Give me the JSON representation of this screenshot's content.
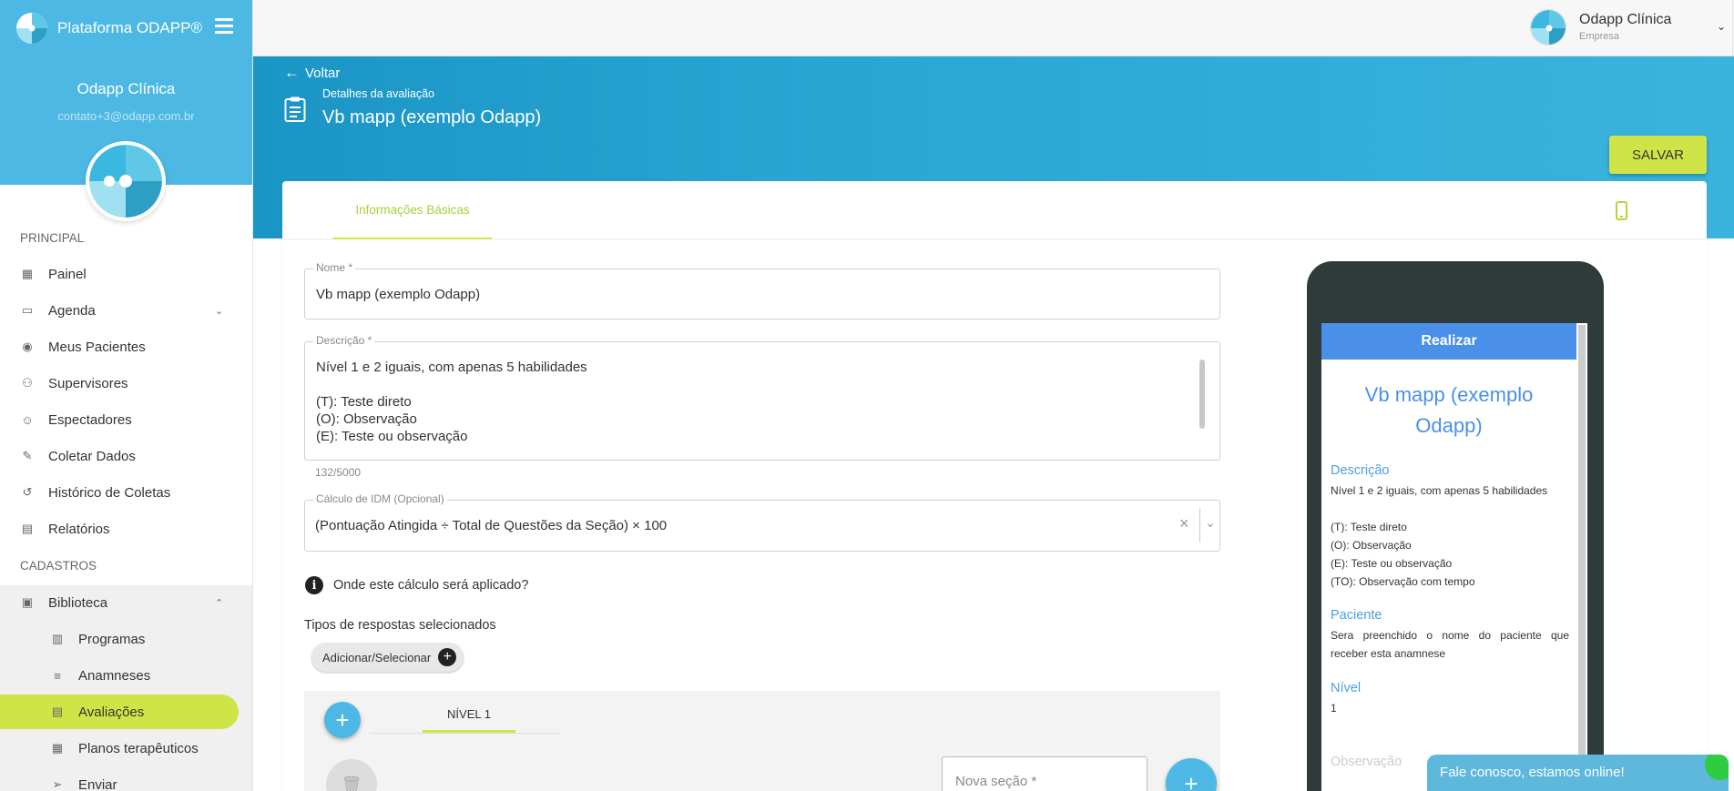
{
  "app": {
    "brand_name": "Plataforma ODAPP®",
    "user_name": "Odapp Clínica",
    "user_email": "contato+3@odapp.com.br"
  },
  "sidebar": {
    "section_principal": "PRINCIPAL",
    "section_cadastros": "CADASTROS",
    "items": [
      {
        "label": "Painel",
        "icon": "dashboard-icon"
      },
      {
        "label": "Agenda",
        "icon": "calendar-icon"
      },
      {
        "label": "Meus Pacientes",
        "icon": "eye-icon"
      },
      {
        "label": "Supervisores",
        "icon": "users-icon"
      },
      {
        "label": "Espectadores",
        "icon": "smile-icon"
      },
      {
        "label": "Coletar Dados",
        "icon": "pencil-icon"
      },
      {
        "label": "Histórico de Coletas",
        "icon": "history-icon"
      },
      {
        "label": "Relatórios",
        "icon": "report-icon"
      },
      {
        "label": "Biblioteca",
        "icon": "library-icon"
      },
      {
        "label": "Programas",
        "icon": "document-icon"
      },
      {
        "label": "Anamneses",
        "icon": "list-icon"
      },
      {
        "label": "Avaliações",
        "icon": "clipboard-icon"
      },
      {
        "label": "Planos terapêuticos",
        "icon": "plan-icon"
      },
      {
        "label": "Enviar",
        "icon": "send-icon"
      }
    ],
    "active_color": "#cfe547"
  },
  "topbar": {
    "company_name": "Odapp Clínica",
    "company_role": "Empresa"
  },
  "header": {
    "back_label": "Voltar",
    "subtitle": "Detalhes da avaliação",
    "title": "Vb mapp (exemplo Odapp)",
    "save_label": "SALVAR"
  },
  "tabs": {
    "basic_info": "Informações Básicas"
  },
  "form": {
    "name_label": "Nome *",
    "name_value": "Vb mapp (exemplo Odapp)",
    "desc_label": "Descrição *",
    "desc_lines": [
      "Nível 1 e 2 iguais, com apenas 5 habilidades",
      "",
      "(T): Teste direto",
      "(O): Observação",
      "(E): Teste ou observação"
    ],
    "desc_counter": "132/5000",
    "idm_label": "Cálculo de IDM (Opcional)",
    "idm_value": "(Pontuação Atingida ÷ Total de Questões da Seção) × 100",
    "idm_help": "Onde este cálculo será aplicado?",
    "response_types_label": "Tipos de respostas selecionados",
    "add_select_label": "Adicionar/Selecionar",
    "level_tab": "NÍVEL 1",
    "new_section_placeholder": "Nova seção *"
  },
  "preview": {
    "header": "Realizar",
    "title": "Vb mapp (exemplo Odapp)",
    "desc_heading": "Descrição",
    "desc_lines": [
      "Nível 1 e 2 iguais, com apenas 5 habilidades",
      "",
      "(T): Teste direto",
      "(O): Observação",
      "(E): Teste ou observação",
      "(TO): Observação com tempo"
    ],
    "patient_heading": "Paciente",
    "patient_text": "Sera preenchido o nome do paciente que receber esta anamnese",
    "level_heading": "Nível",
    "level_value": "1",
    "obs_placeholder": "Observação"
  },
  "chat": {
    "label": "Fale conosco, estamos online!"
  }
}
